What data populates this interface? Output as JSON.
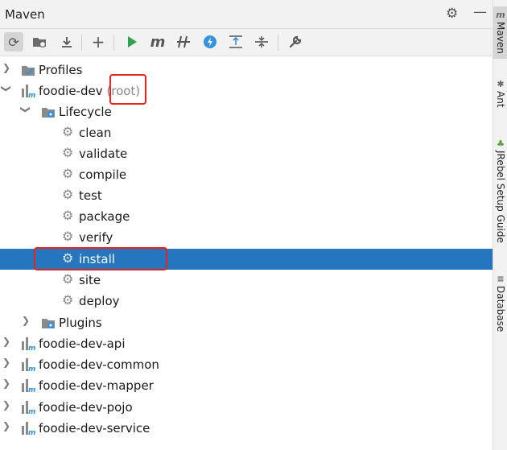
{
  "window": {
    "title": "Maven"
  },
  "title_icons": [
    "gear-icon",
    "minimize-icon"
  ],
  "toolbar": {
    "buttons": [
      {
        "name": "reload-icon",
        "glyph": "⟳"
      },
      {
        "name": "add-folder-icon",
        "glyph": "▣"
      },
      {
        "name": "download-icon",
        "glyph": "⤓"
      },
      {
        "name": "add-icon",
        "glyph": "+"
      },
      {
        "name": "run-icon",
        "glyph": "▶"
      },
      {
        "name": "maven-goal-icon",
        "glyph": "m"
      },
      {
        "name": "skip-tests-icon",
        "glyph": "⫽"
      },
      {
        "name": "offline-mode-icon",
        "glyph": "ϟ"
      },
      {
        "name": "expand-all-icon",
        "glyph": "⇅"
      },
      {
        "name": "collapse-all-icon",
        "glyph": "⇵"
      },
      {
        "name": "settings-wrench-icon",
        "glyph": "🔧"
      }
    ],
    "accent_run": "#2ea44f",
    "accent_bolt": "#3592e0"
  },
  "tree": {
    "profiles": "Profiles",
    "root_project": "foodie-dev",
    "root_suffix": "(root)",
    "lifecycle": "Lifecycle",
    "lifecycle_items": [
      "clean",
      "validate",
      "compile",
      "test",
      "package",
      "verify",
      "install",
      "site",
      "deploy"
    ],
    "plugins": "Plugins",
    "modules": [
      "foodie-dev-api",
      "foodie-dev-common",
      "foodie-dev-mapper",
      "foodie-dev-pojo",
      "foodie-dev-service"
    ],
    "selected": "install",
    "selection_color": "#2675bf",
    "highlight_color": "#e8231a"
  },
  "side_tabs": [
    {
      "label": "Maven",
      "icon": "m"
    },
    {
      "label": "Ant",
      "icon": "🐜"
    },
    {
      "label": "JRebel Setup Guide",
      "icon": "♣"
    },
    {
      "label": "Database",
      "icon": "≡"
    }
  ]
}
